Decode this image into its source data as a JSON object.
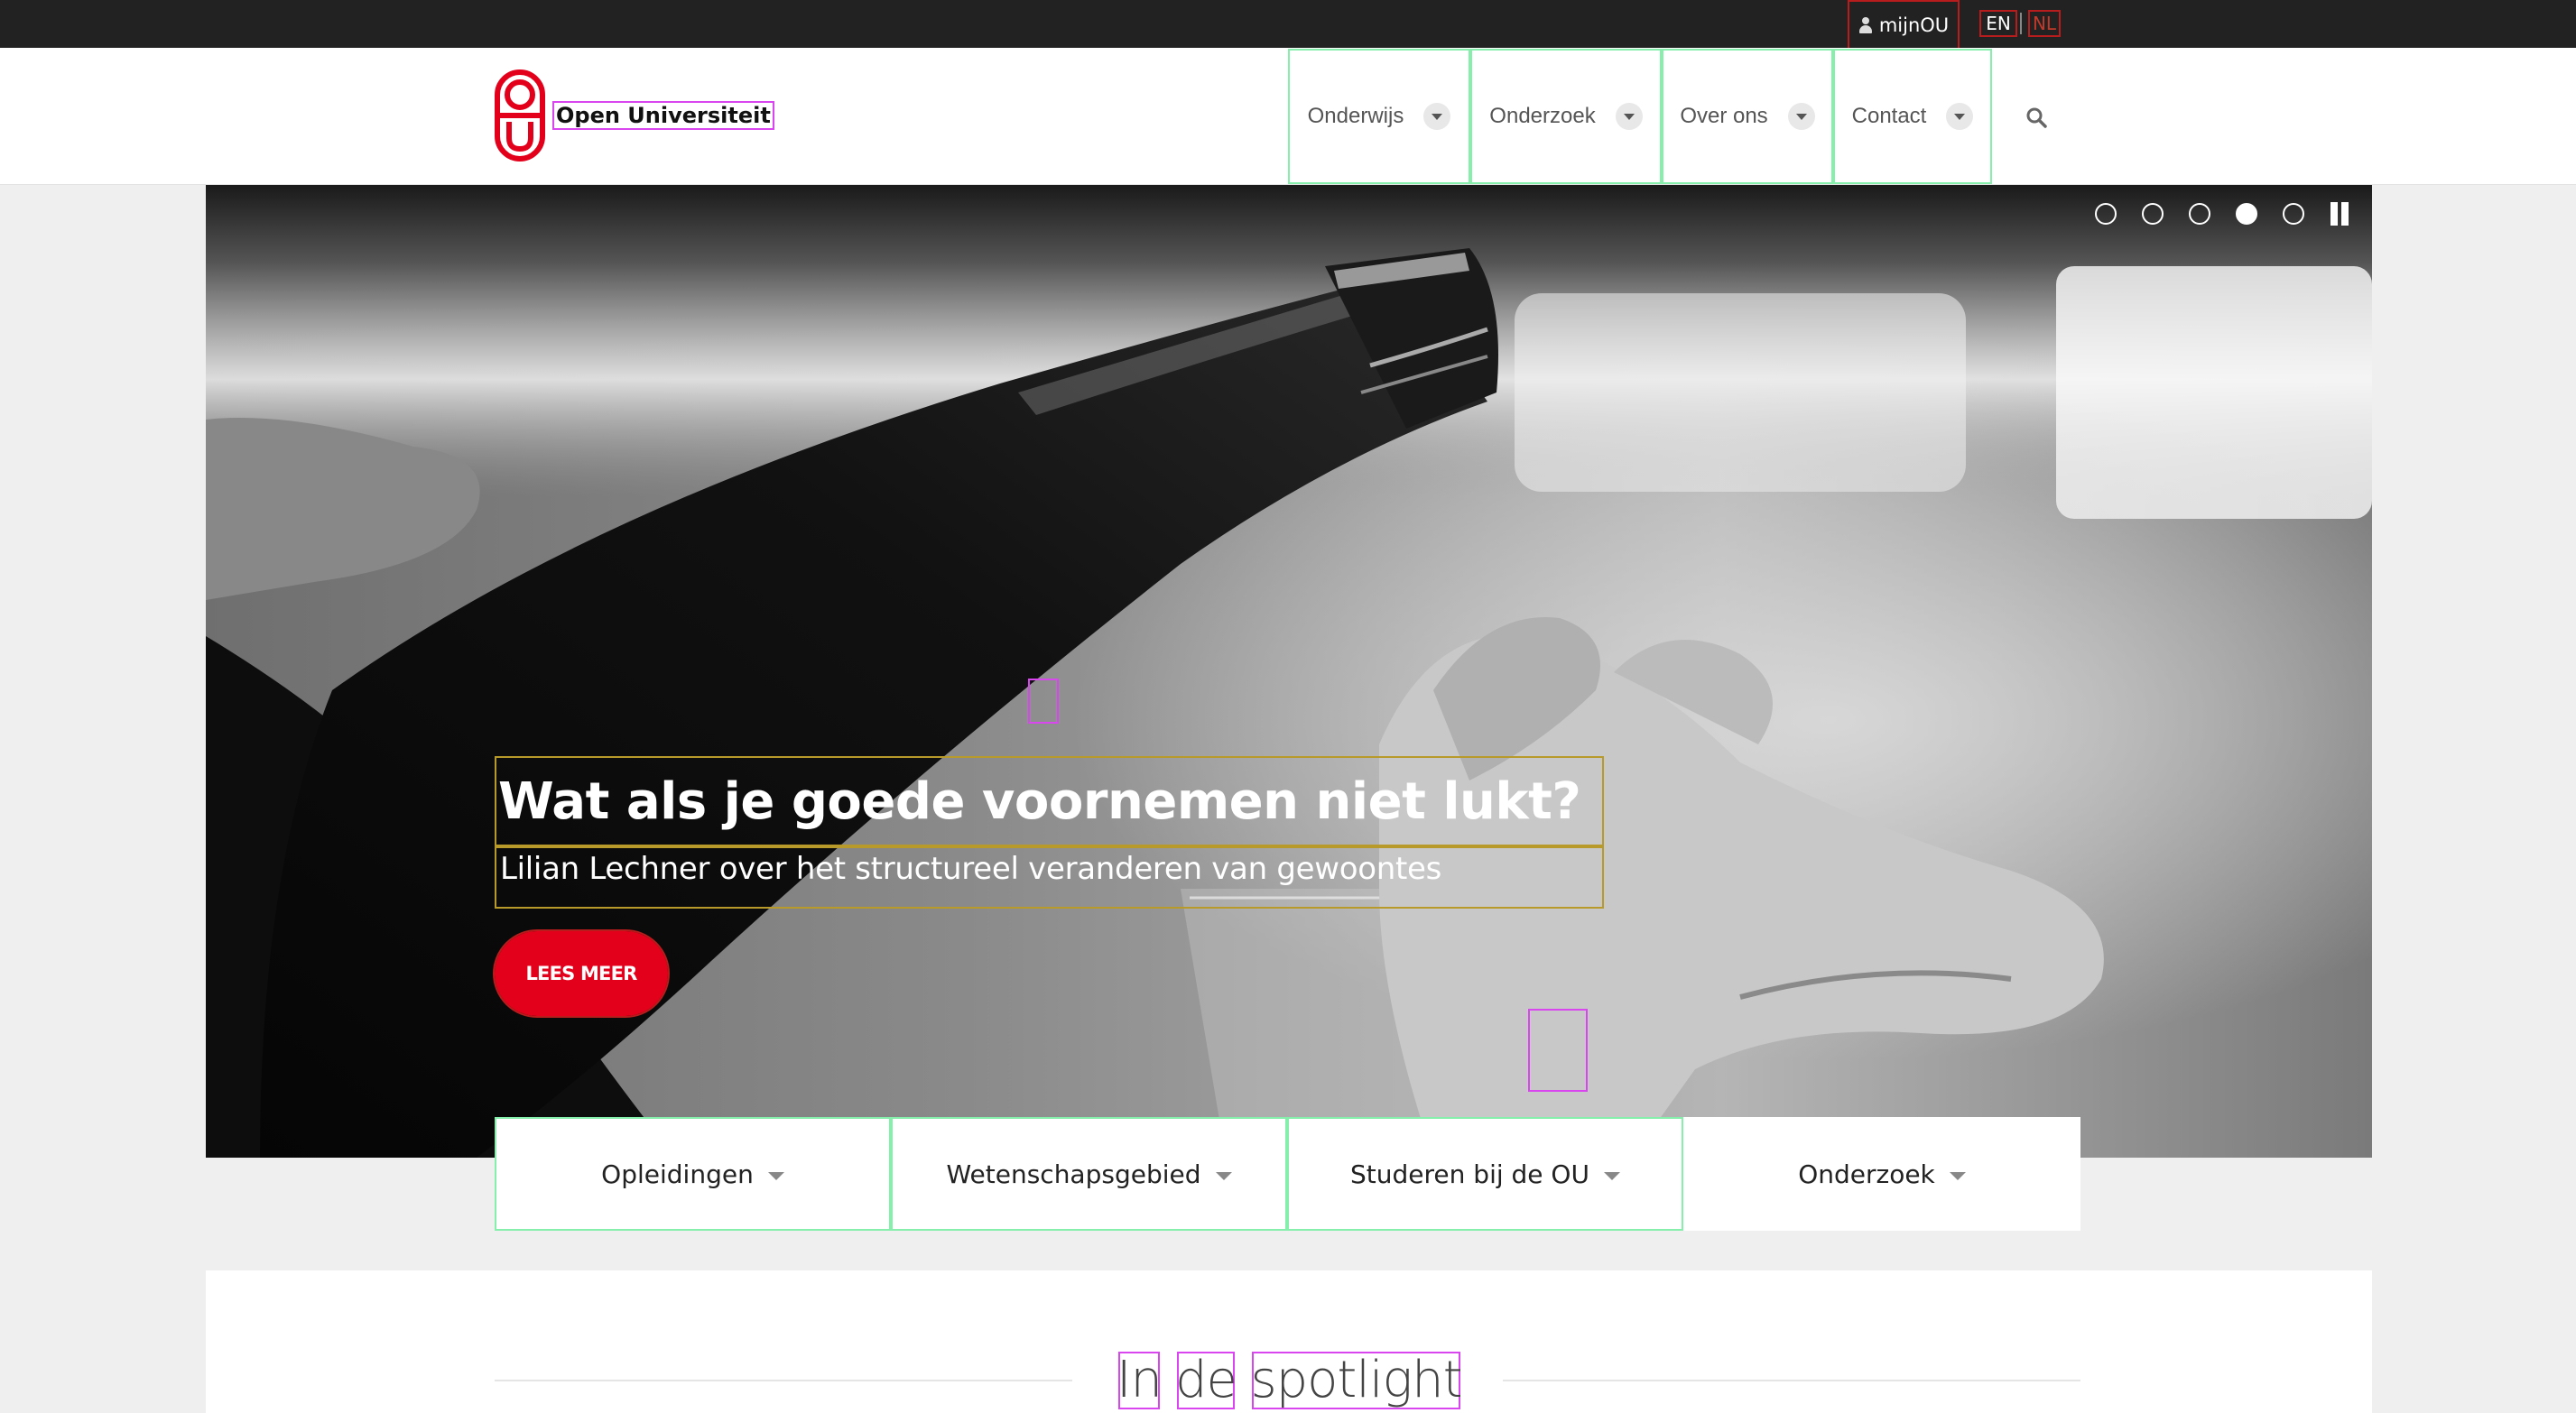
{
  "topbar": {
    "account_label": "mijnOU",
    "languages": [
      "EN",
      "NL"
    ]
  },
  "header": {
    "brand": "Open Universiteit",
    "nav": [
      "Onderwijs",
      "Onderzoek",
      "Over ons",
      "Contact"
    ],
    "search_icon": "search-icon",
    "brand_color": "#e3001b"
  },
  "hero": {
    "title": "Wat als je goede voornemen niet lukt?",
    "subtitle": "Lilian Lechner over het structureel veranderen van gewoontes",
    "cta": "LEES MEER",
    "slides": 5,
    "active_slide": 4
  },
  "categories": [
    "Opleidingen",
    "Wetenschapsgebied",
    "Studeren bij de OU",
    "Onderzoek"
  ],
  "spotlight": {
    "words": [
      "In",
      "de",
      "spotlight"
    ]
  }
}
